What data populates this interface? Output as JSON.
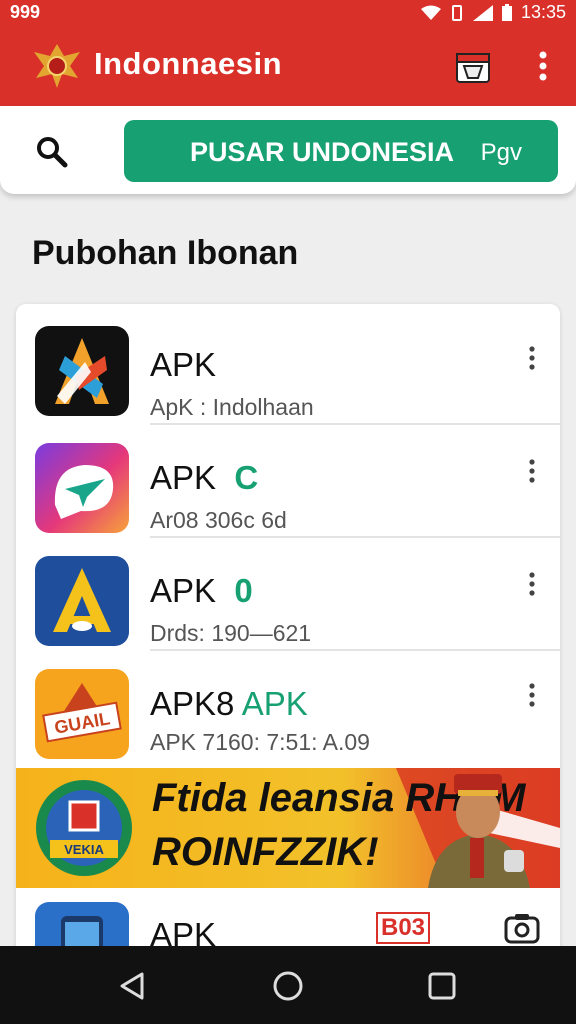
{
  "status_bar": {
    "left_text": "999",
    "time": "13:35"
  },
  "app_bar": {
    "title": "Indonnaesin"
  },
  "search": {
    "button_label": "PUSAR UNDONESIA",
    "button_sub": "Pgv"
  },
  "section": {
    "title": "Pubohan Ibonan"
  },
  "apps": [
    {
      "title": "APK",
      "accent": "",
      "subtitle": "ApK : Indolhaan"
    },
    {
      "title": "APK",
      "accent": "C",
      "subtitle": "Ar08 306c 6d"
    },
    {
      "title": "APK",
      "accent": "0",
      "subtitle": "Drds: 190—621"
    },
    {
      "title": "APK8",
      "accent": "APK",
      "subtitle": "APK 7160: 7:51: A.09"
    },
    {
      "title": "APK",
      "accent": "",
      "subtitle": "",
      "badge": "B03"
    }
  ],
  "banner": {
    "line1": "Ftida leansia RHUM",
    "line2": "ROINFZZIK!",
    "logo_text": "VEKIA",
    "icon_text": "GUAIL"
  },
  "colors": {
    "primary_red": "#d9302a",
    "accent_green": "#17a072"
  }
}
